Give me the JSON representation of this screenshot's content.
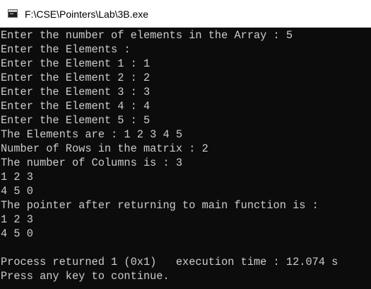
{
  "window": {
    "title": "F:\\CSE\\Pointers\\Lab\\3B.exe",
    "icon": "console-app-icon"
  },
  "console": {
    "lines": [
      "Enter the number of elements in the Array : 5",
      "Enter the Elements :",
      "Enter the Element 1 : 1",
      "Enter the Element 2 : 2",
      "Enter the Element 3 : 3",
      "Enter the Element 4 : 4",
      "Enter the Element 5 : 5",
      "The Elements are : 1 2 3 4 5",
      "Number of Rows in the matrix : 2",
      "The number of Columns is : 3",
      "1 2 3",
      "4 5 0",
      "The pointer after returning to main function is :",
      "1 2 3",
      "4 5 0",
      "",
      "Process returned 1 (0x1)   execution time : 12.074 s",
      "Press any key to continue."
    ]
  }
}
